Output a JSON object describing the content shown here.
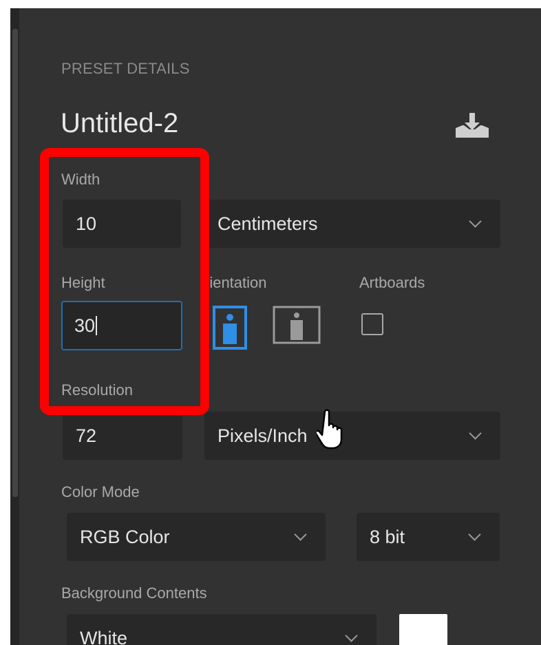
{
  "preset": {
    "section_label": "PRESET DETAILS",
    "document_name": "Untitled-2"
  },
  "width": {
    "label": "Width",
    "value": "10",
    "unit": "Centimeters"
  },
  "height": {
    "label": "Height",
    "value": "30"
  },
  "orientation": {
    "label": "rientation",
    "selected": "portrait"
  },
  "artboards": {
    "label": "Artboards",
    "checked": false
  },
  "resolution": {
    "label": "Resolution",
    "value": "72",
    "unit": "Pixels/Inch"
  },
  "color_mode": {
    "label": "Color Mode",
    "mode": "RGB Color",
    "depth": "8 bit"
  },
  "background": {
    "label": "Background Contents",
    "value": "White",
    "swatch_color": "#ffffff"
  },
  "colors": {
    "accent": "#1f6fb5",
    "highlight": "#ff0000",
    "panel": "#323232"
  },
  "icons": [
    "save-preset-icon",
    "portrait-icon",
    "landscape-icon",
    "chevron-down-icon",
    "hand-cursor-icon"
  ]
}
